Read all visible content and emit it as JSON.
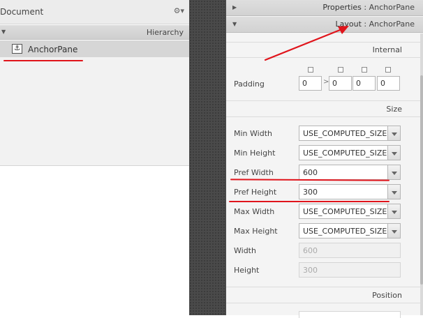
{
  "document": {
    "title": "Document",
    "gear_icon": "gear-icon"
  },
  "hierarchy": {
    "title": "Hierarchy",
    "items": [
      {
        "label": "AnchorPane",
        "icon": "anchor-icon"
      }
    ]
  },
  "inspector": {
    "properties": {
      "title": "Properties",
      "separator": " : ",
      "target": "AnchorPane"
    },
    "layout": {
      "title": "Layout",
      "separator": " : ",
      "target": "AnchorPane"
    },
    "internal_label": "Internal",
    "padding": {
      "label": "Padding",
      "values": [
        "0",
        "0",
        "0",
        "0"
      ]
    },
    "size_label": "Size",
    "size_props": [
      {
        "label": "Min Width",
        "value": "USE_COMPUTED_SIZE"
      },
      {
        "label": "Min Height",
        "value": "USE_COMPUTED_SIZE"
      },
      {
        "label": "Pref Width",
        "value": "600"
      },
      {
        "label": "Pref Height",
        "value": "300"
      },
      {
        "label": "Max Width",
        "value": "USE_COMPUTED_SIZE"
      },
      {
        "label": "Max Height",
        "value": "USE_COMPUTED_SIZE"
      }
    ],
    "readonly_props": [
      {
        "label": "Width",
        "value": "600"
      },
      {
        "label": "Height",
        "value": "300"
      }
    ],
    "position_label": "Position"
  },
  "colors": {
    "annotation": "#e0141b"
  }
}
